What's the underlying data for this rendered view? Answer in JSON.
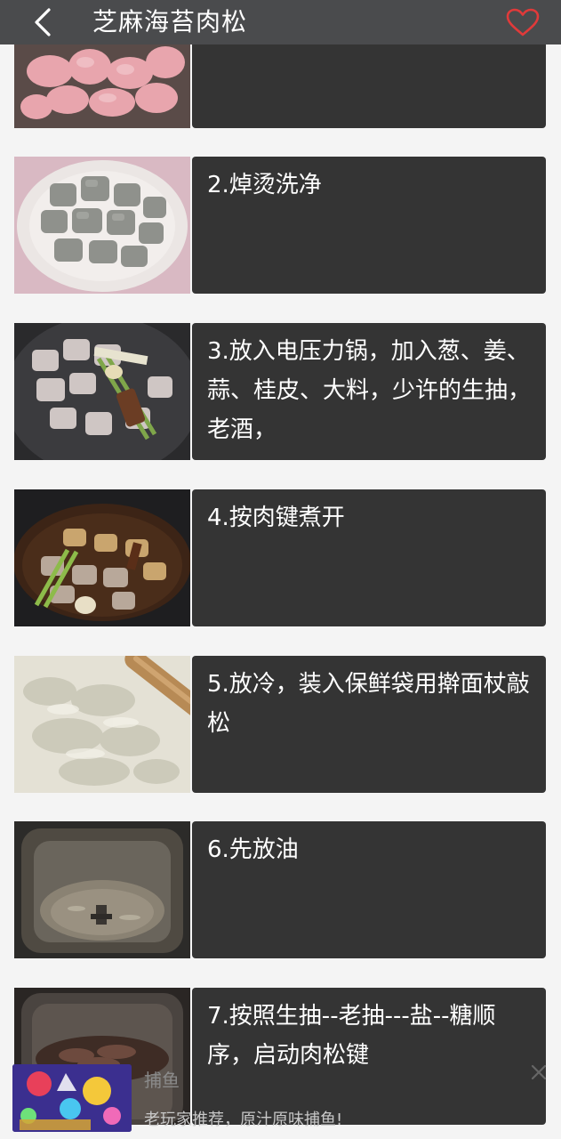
{
  "header": {
    "back_icon": "chevron-left-icon",
    "title": "芝麻海苔肉松",
    "favorite_icon": "heart-outline-icon",
    "background": "#4a4b4d",
    "favorite_color": "#e03a3a"
  },
  "steps": [
    {
      "text": "",
      "image": "raw pork cubes"
    },
    {
      "text": "2.焯烫洗净",
      "image": "blanched pork on plate"
    },
    {
      "text": "3.放入电压力锅，加入葱、姜、蒜、桂皮、大料，少许的生抽，老酒，",
      "image": "pork with aromatics in pot"
    },
    {
      "text": "4.按肉键煮开",
      "image": "pork cooked in sauce"
    },
    {
      "text": "5.放冷，装入保鲜袋用擀面杖敲松",
      "image": "pounded pork in bag with rolling pin"
    },
    {
      "text": "6.先放油",
      "image": "oil in bread machine pan"
    },
    {
      "text": "7.按照生抽--老抽---盐--糖顺序，启动肉松键",
      "image": "pork floss in bread machine"
    }
  ],
  "ad": {
    "title": "捕鱼",
    "description": "老玩家推荐，原汁原味捕鱼!",
    "close_icon": "close-icon"
  }
}
